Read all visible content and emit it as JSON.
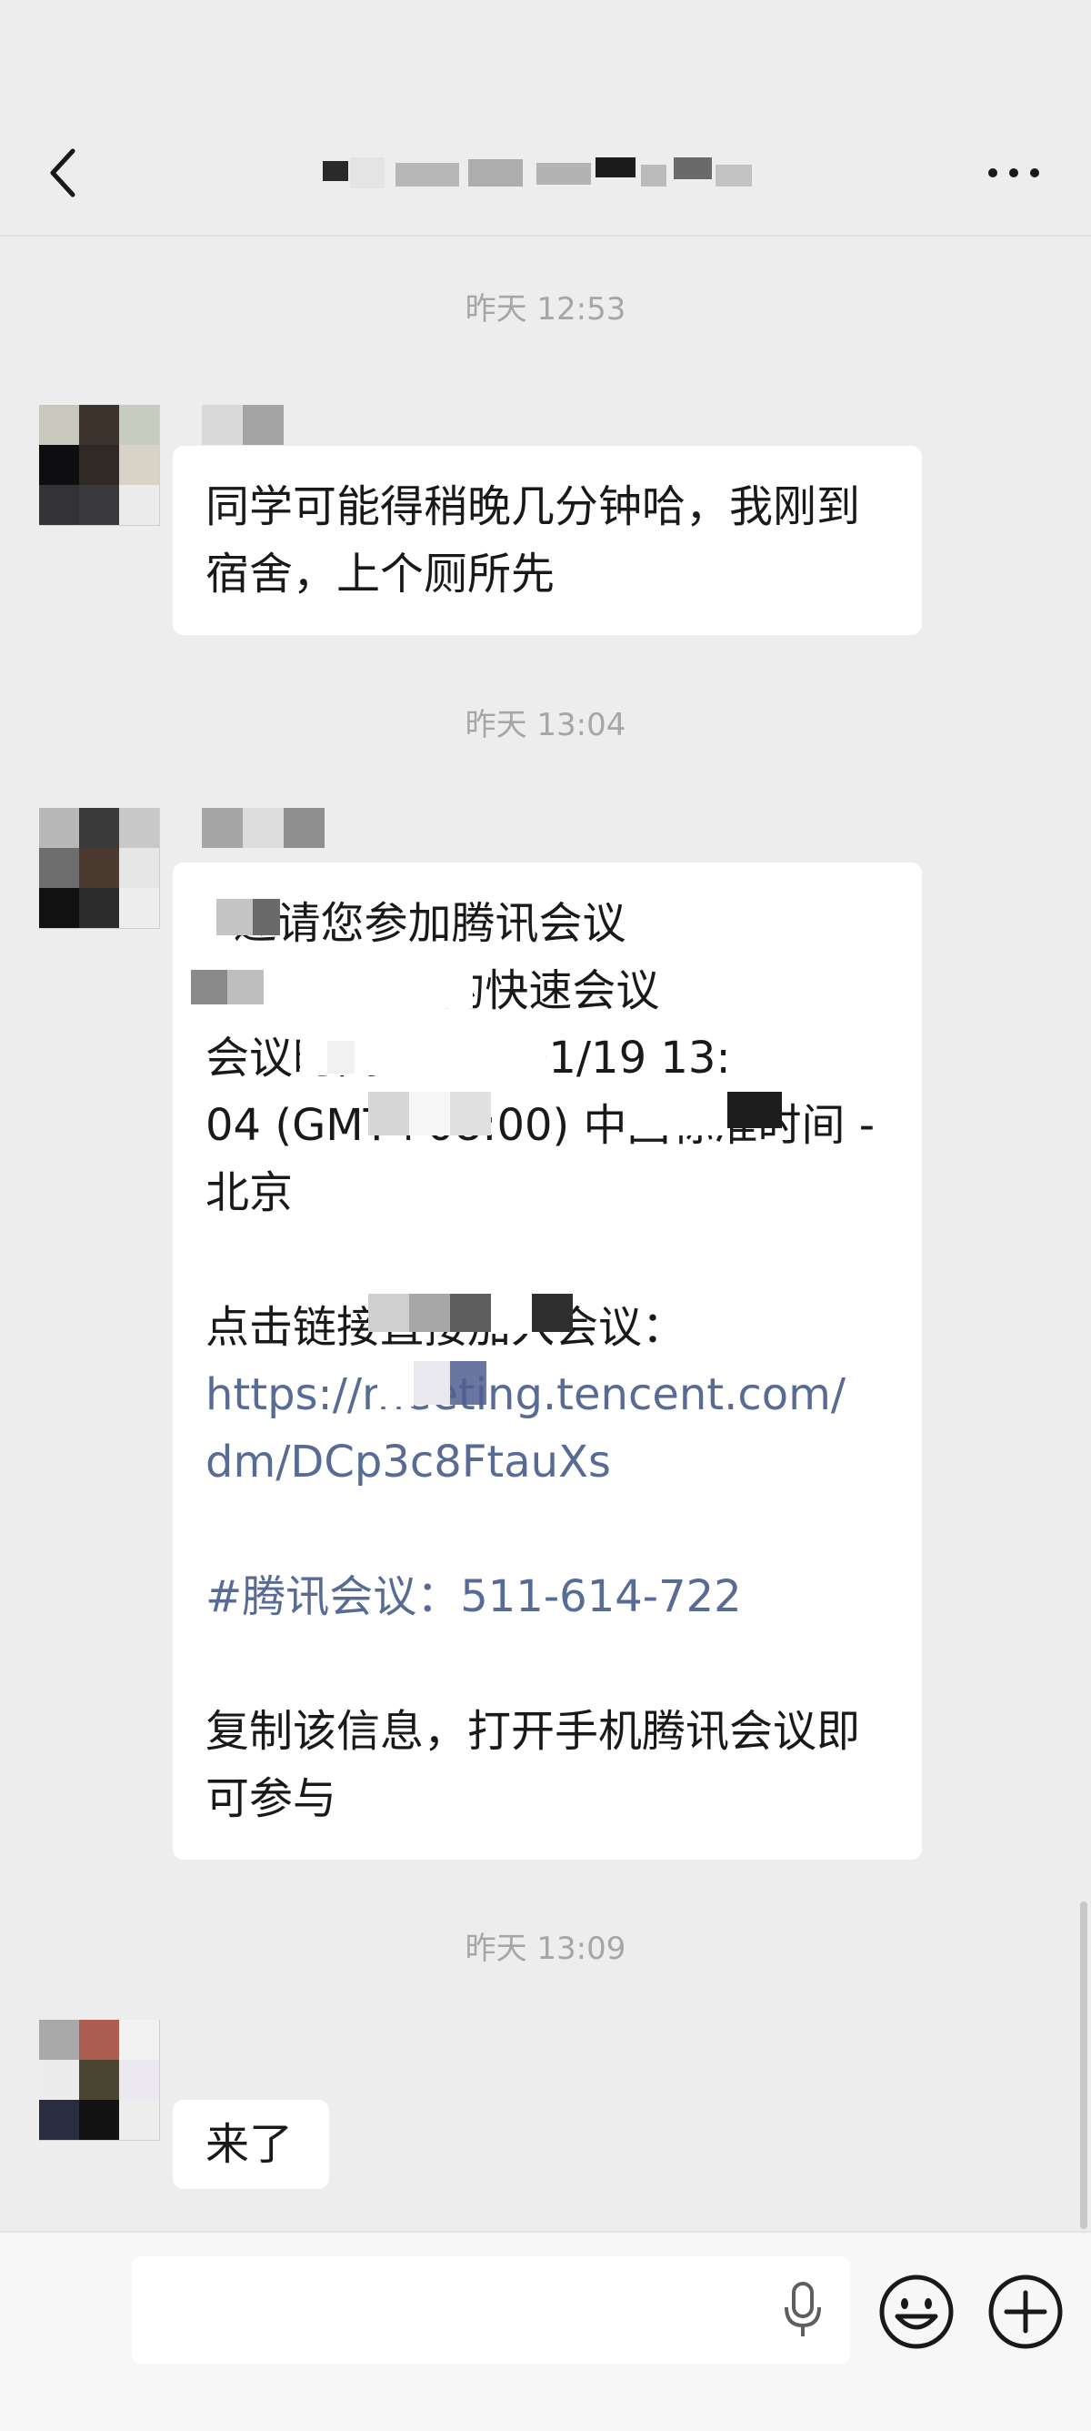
{
  "header": {
    "title": "",
    "back_icon": "chevron-left-icon",
    "more_icon": "more-dots-icon"
  },
  "messages": [
    {
      "time": "昨天 12:53",
      "lines": [
        "同学可能得稍晚几分钟哈，我刚到",
        "宿舍，上个厕所先"
      ]
    },
    {
      "time": "昨天 13:04",
      "invite_lines": [
        "  邀请您参加腾讯会议",
        "                 的快速会议",
        "会议时间：       01/19 13:",
        "04 (GMT+08:00) 中国标准时间 -",
        "北京"
      ],
      "join_label": "点击链接直接加入会议：",
      "link_lines": [
        "https://meeting.tencent.com/",
        "dm/DCp3c8FtauXs"
      ],
      "meeting_id": "#腾讯会议：511-614-722",
      "copy_lines": [
        "复制该信息，打开手机腾讯会议即",
        "可参与"
      ]
    },
    {
      "time": "昨天 13:09",
      "text": "来了"
    }
  ],
  "input_bar": {
    "placeholder": "",
    "voice_icon": "microphone-icon",
    "emoji_icon": "emoji-icon",
    "plus_icon": "plus-circle-icon"
  },
  "colors": {
    "background": "#ededed",
    "bubble": "#ffffff",
    "link": "#576b95",
    "timestamp": "#a6a6a6"
  }
}
